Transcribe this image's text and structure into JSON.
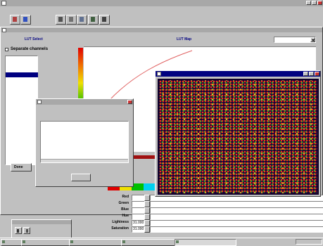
{
  "app": {
    "title": ""
  },
  "menu": [
    "",
    "",
    "",
    "",
    "",
    ""
  ],
  "top_labels": {
    "lut_select": "LUT Select",
    "lut_map": "LUT Map"
  },
  "map_dropdown": {
    "value": ""
  },
  "separate_channels": {
    "label": "Separate channels"
  },
  "samples": [
    {
      "name": "",
      "selected": false
    },
    {
      "name": "",
      "selected": false
    },
    {
      "name": "",
      "selected": false
    },
    {
      "name": "",
      "selected": true
    }
  ],
  "lut_ticks": [
    "",
    "",
    "",
    "",
    "",
    "",
    "",
    ""
  ],
  "done_button": "Done",
  "log_window": {
    "title": "",
    "menu": [
      "",
      ""
    ],
    "label": "",
    "text": "",
    "footer": "",
    "button": ""
  },
  "image_window": {
    "title": ""
  },
  "color_bar": {
    "label": "",
    "swatches": [
      "#e00000",
      "#f0e000",
      "#00c000",
      "#00d0f0"
    ]
  },
  "params": [
    {
      "label": "Red",
      "value": ""
    },
    {
      "label": "Green",
      "value": ""
    },
    {
      "label": "Blue",
      "value": ""
    },
    {
      "label": "Hue",
      "value": ""
    },
    {
      "label": "Lightness",
      "value": "31.000"
    },
    {
      "label": "Saturation",
      "value": "31.000"
    }
  ],
  "small_window": {
    "title": ""
  },
  "taskbar": {
    "start": "",
    "tasks": [
      "",
      "",
      "",
      ""
    ],
    "clock": ""
  },
  "colors": {
    "title_active": "#000080",
    "title_inactive": "#a8a8a8",
    "curve": "#e06060"
  }
}
